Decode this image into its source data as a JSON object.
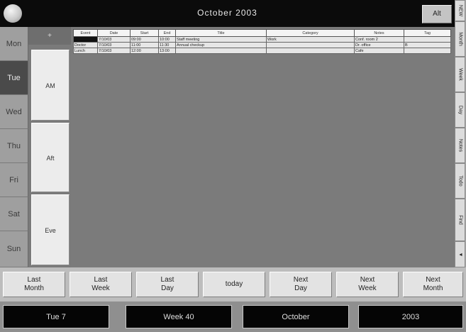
{
  "window": {
    "title": "October 2003",
    "right_button": "Alt"
  },
  "right_tabs": [
    "NEW",
    "Month",
    "Week",
    "Day",
    "Notes",
    "Todo",
    "Find",
    "▼"
  ],
  "days": [
    "Mon",
    "Tue",
    "Wed",
    "Thu",
    "Fri",
    "Sat",
    "Sun"
  ],
  "active_day": "Tue",
  "time_slots": {
    "header": "+",
    "slots": [
      "AM",
      "Aft",
      "Eve"
    ]
  },
  "grid": {
    "columns": [
      "Event",
      "Date",
      "Start",
      "End",
      "Title",
      "Category",
      "Notes",
      "Tag"
    ],
    "rows": [
      [
        "",
        "7/10/03",
        "09:00",
        "10:00",
        "Staff meeting",
        "Work",
        "Conf. room 2",
        ""
      ],
      [
        "Doctor",
        "7/10/03",
        "11:00",
        "11:30",
        "Annual checkup",
        "",
        "Dr. office",
        "B"
      ],
      [
        "Lunch",
        "7/10/03",
        "12:00",
        "13:00",
        "",
        "",
        "Cafe",
        ""
      ]
    ]
  },
  "nav": [
    "Last\nMonth",
    "Last\nWeek",
    "Last\nDay",
    "today",
    "Next\nDay",
    "Next\nWeek",
    "Next\nMonth"
  ],
  "status": {
    "date": "Tue 7",
    "week": "Week 40",
    "month": "October",
    "year": "2003"
  }
}
